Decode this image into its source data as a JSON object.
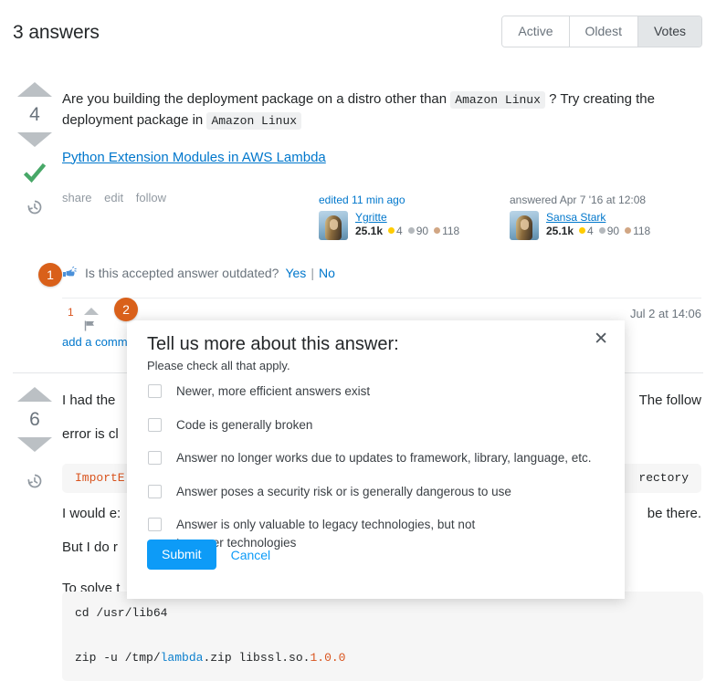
{
  "header": {
    "answers_count": "3 answers",
    "tabs": [
      {
        "label": "Active",
        "selected": false
      },
      {
        "label": "Oldest",
        "selected": false
      },
      {
        "label": "Votes",
        "selected": true
      }
    ]
  },
  "colors": {
    "accent_blue": "#0077cc",
    "submit_blue": "#0d9bf7",
    "badge_orange": "#d9601a",
    "accepted_green": "#48a868",
    "code_orange": "#d9541e",
    "gold": "#ffcc01",
    "silver": "#b4b8bc",
    "bronze": "#d1a684"
  },
  "answers": [
    {
      "score": "4",
      "accepted_icon": "checkmark-icon",
      "history_icon": "history-clock-icon",
      "body": {
        "p1_a": "Are you building the deployment package on a distro other than ",
        "code1": "Amazon Linux",
        "p1_b": " ? Try creating the deployment package in ",
        "code2": "Amazon Linux",
        "link_text": "Python Extension Modules in AWS Lambda"
      },
      "actions": [
        "share",
        "edit",
        "follow"
      ],
      "editor": {
        "when": "edited 11 min ago",
        "name": "Ygritte",
        "rep": "25.1k",
        "gold": "4",
        "silver": "90",
        "bronze": "118"
      },
      "author": {
        "when": "answered Apr 7 '16 at 12:08",
        "name": "Sansa Stark",
        "rep": "25.1k",
        "gold": "4",
        "silver": "90",
        "bronze": "118"
      },
      "outdated_prompt": {
        "hand_icon": "pointing-hand-icon",
        "question": "Is this accepted answer outdated?",
        "yes": "Yes",
        "separator": "|",
        "no": "No"
      },
      "comment": {
        "score": "1",
        "date": "Jul 2 at 14:06"
      },
      "add_comment": "add a comment"
    },
    {
      "score": "6",
      "history_icon": "history-clock-icon",
      "body": {
        "p1_a": "I had the",
        "p1_b": "The follow",
        "p2_a": "error is cl",
        "code_left": "ImportE",
        "code_right": "rectory",
        "p3_a": "I would e:",
        "p3_b": "be there.",
        "p3_c": "But I do r",
        "p4": "To solve t"
      },
      "codeblock": {
        "line1": "cd /usr/lib64",
        "line2_a": "zip -u /tmp/",
        "line2_str": "lambda",
        "line2_b": ".zip libssl.so.",
        "line2_num": "1.0.0"
      }
    }
  ],
  "modal": {
    "title": "Tell us more about this answer:",
    "subtitle": "Please check all that apply.",
    "close_icon": "close-icon",
    "options": [
      "Newer, more efficient answers exist",
      "Code is generally broken",
      "Answer no longer works due to updates to framework, library, language, etc.",
      "Answer poses a security risk or is generally dangerous to use",
      "Answer is only valuable to legacy technologies, but not to newer technologies"
    ],
    "submit_label": "Submit",
    "cancel_label": "Cancel"
  },
  "step_badges": [
    {
      "number": "1"
    },
    {
      "number": "2"
    }
  ]
}
